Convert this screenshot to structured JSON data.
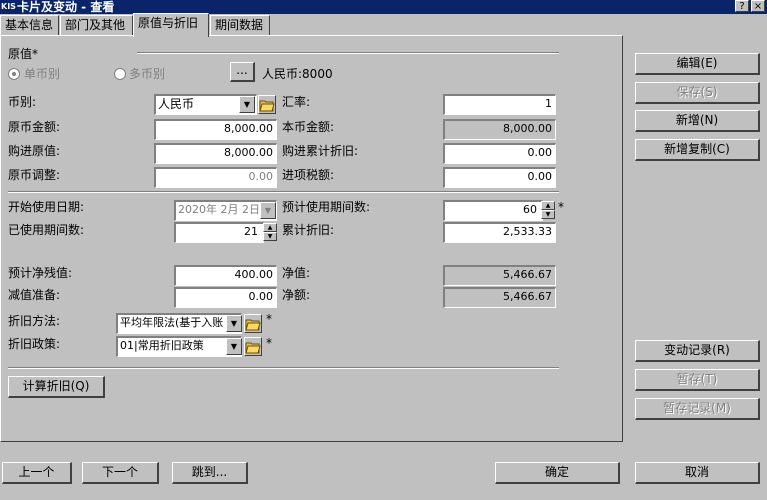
{
  "window": {
    "title": "卡片及变动 - 查看",
    "help_glyph": "?",
    "close_glyph": "×",
    "logo_text": "KIS"
  },
  "tabs": [
    {
      "label": "基本信息"
    },
    {
      "label": "部门及其他"
    },
    {
      "label": "原值与折旧"
    },
    {
      "label": "期间数据"
    }
  ],
  "original": {
    "section_label": "原值*",
    "single_currency": "单币别",
    "multi_currency": "多币别",
    "ellipsis": "...",
    "rmb_summary": "人民币:8000",
    "currency_label": "币别:",
    "currency_value": "人民币",
    "rate_label": "汇率:",
    "rate_value": "1",
    "orig_amount_label": "原币金额:",
    "orig_amount_value": "8,000.00",
    "local_amount_label": "本币金额:",
    "local_amount_value": "8,000.00",
    "purchase_value_label": "购进原值:",
    "purchase_value_value": "8,000.00",
    "purchase_dep_label": "购进累计折旧:",
    "purchase_dep_value": "0.00",
    "orig_adjust_label": "原币调整:",
    "orig_adjust_value": "0.00",
    "input_tax_label": "进项税额:",
    "input_tax_value": "0.00"
  },
  "depreciation": {
    "start_date_label": "开始使用日期:",
    "start_date_value": "2020年 2月 2日",
    "expected_periods_label": "预计使用期间数:",
    "expected_periods_value": "60",
    "used_periods_label": "已使用期间数:",
    "used_periods_value": "21",
    "accum_dep_label": "累计折旧:",
    "accum_dep_value": "2,533.33",
    "residual_label": "预计净残值:",
    "residual_value": "400.00",
    "net_value_label": "净值:",
    "net_value_value": "5,466.67",
    "impairment_label": "减值准备:",
    "impairment_value": "0.00",
    "net_amount_label": "净额:",
    "net_amount_value": "5,466.67",
    "method_label": "折旧方法:",
    "method_value": "平均年限法(基于入账",
    "policy_label": "折旧政策:",
    "policy_value": "01|常用折旧政策",
    "required_mark": "*",
    "calc_button": "计算折旧(Q)"
  },
  "side_buttons": {
    "edit": "编辑(E)",
    "save": "保存(S)",
    "new": "新增(N)",
    "new_copy": "新增复制(C)",
    "change_log": "变动记录(R)",
    "temp_save": "暂存(T)",
    "temp_log": "暂存记录(M)"
  },
  "bottom_buttons": {
    "prev": "上一个",
    "next": "下一个",
    "jump": "跳到...",
    "ok": "确定",
    "cancel": "取消"
  }
}
